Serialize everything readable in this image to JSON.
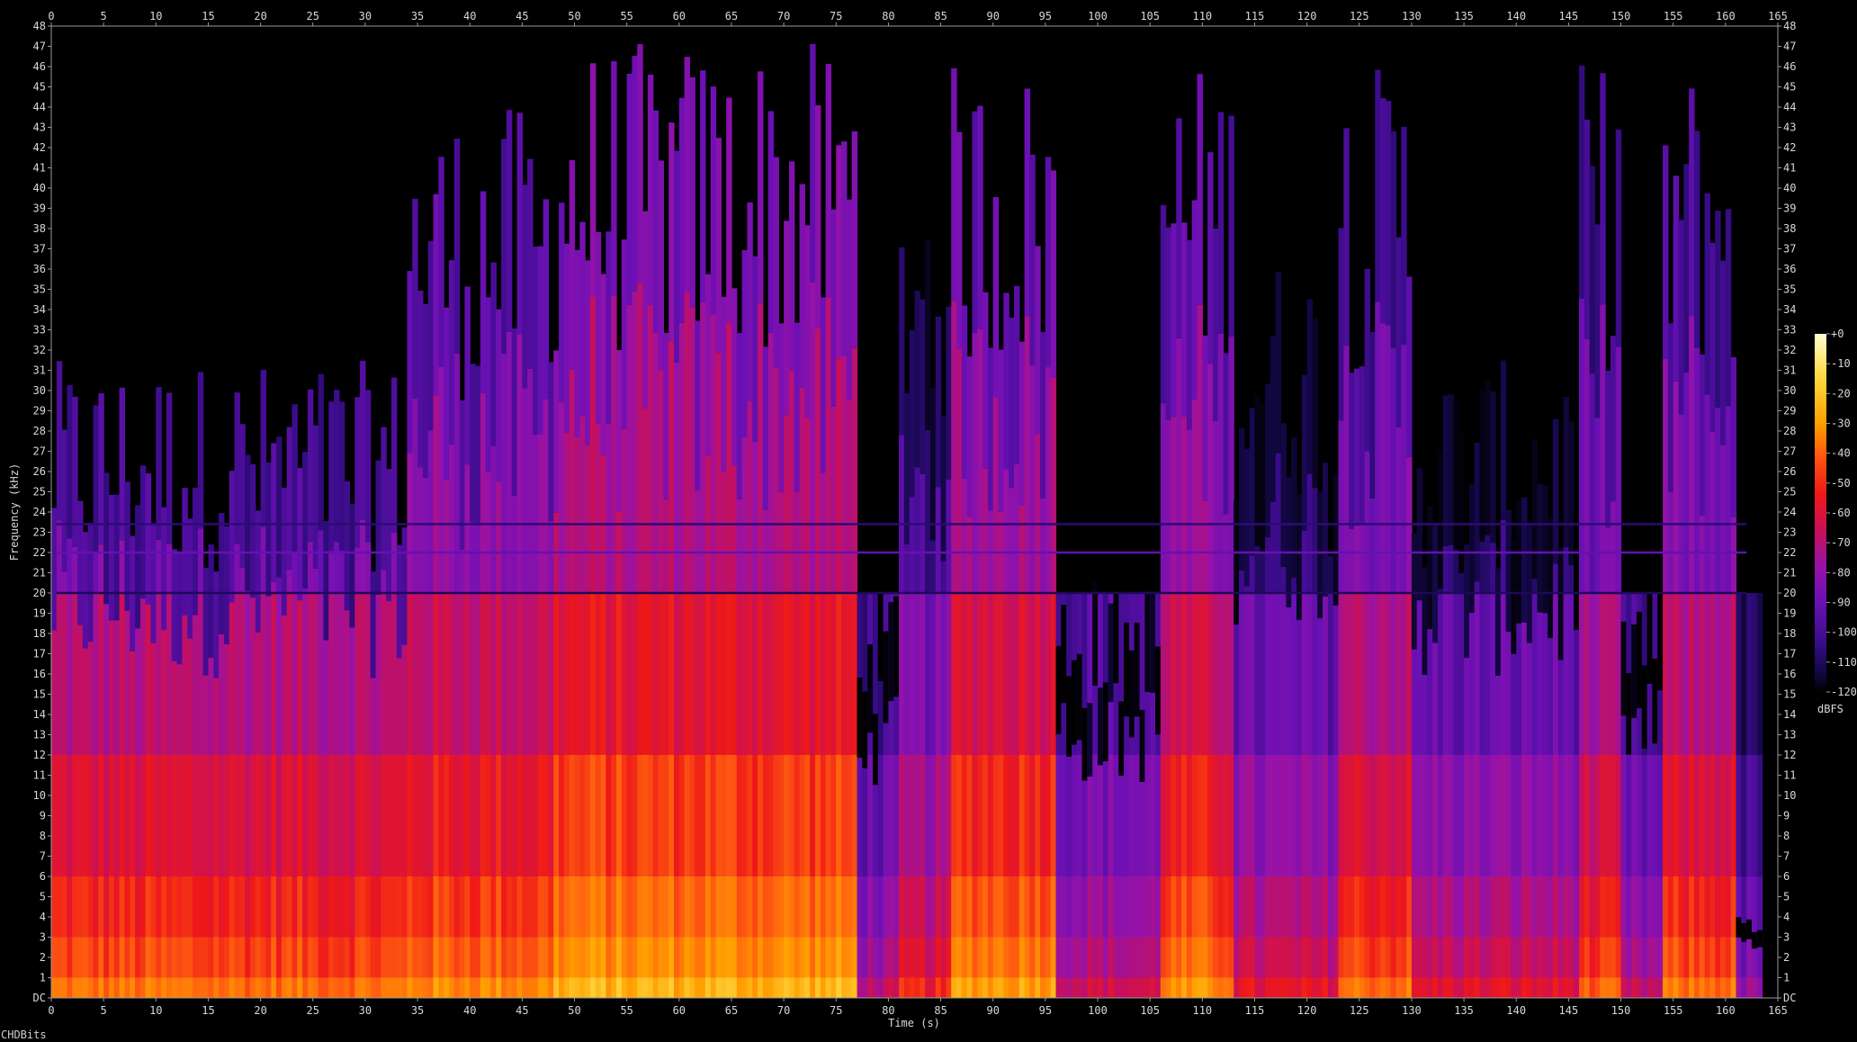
{
  "chart_data": {
    "type": "heatmap",
    "xlabel": "Time (s)",
    "ylabel": "Frequency (kHz)",
    "xlim": [
      0,
      165
    ],
    "ylim": [
      0,
      48
    ],
    "x_ticks": [
      0,
      5,
      10,
      15,
      20,
      25,
      30,
      35,
      40,
      45,
      50,
      55,
      60,
      65,
      70,
      75,
      80,
      85,
      90,
      95,
      100,
      105,
      110,
      115,
      120,
      125,
      130,
      135,
      140,
      145,
      150,
      155,
      160,
      165
    ],
    "y_ticks": [
      "DC",
      "1",
      "2",
      "3",
      "4",
      "5",
      "6",
      "7",
      "8",
      "9",
      "10",
      "11",
      "12",
      "13",
      "14",
      "15",
      "16",
      "17",
      "18",
      "19",
      "20",
      "21",
      "22",
      "23",
      "24",
      "25",
      "26",
      "27",
      "28",
      "29",
      "30",
      "31",
      "32",
      "33",
      "34",
      "35",
      "36",
      "37",
      "38",
      "39",
      "40",
      "41",
      "42",
      "43",
      "44",
      "45",
      "46",
      "47",
      "48"
    ],
    "colorbar": {
      "label": "dBFS",
      "range": [
        -120,
        0
      ],
      "ticks": [
        "+0",
        "-10",
        "-20",
        "-30",
        "-40",
        "-50",
        "-60",
        "-70",
        "-80",
        "-90",
        "-100",
        "-110",
        "-120"
      ],
      "colors": [
        "#000000",
        "#14084a",
        "#3a0c8a",
        "#6a10b4",
        "#9612a8",
        "#c8105a",
        "#ee1818",
        "#ff6010",
        "#ffa000",
        "#ffd840",
        "#ffffc8"
      ]
    },
    "signal_end_s": 163.5,
    "horizontal_lines_khz": [
      {
        "freq": 22.0,
        "level_dbfs": -85
      },
      {
        "freq": 23.4,
        "level_dbfs": -100
      },
      {
        "freq": 20.0,
        "level_dbfs": -105
      }
    ],
    "segments": [
      {
        "start": 0.5,
        "end": 34,
        "level_dbfs": -55,
        "top_khz": 30
      },
      {
        "start": 34,
        "end": 48,
        "level_dbfs": -50,
        "top_khz": 42
      },
      {
        "start": 48,
        "end": 77,
        "level_dbfs": -42,
        "top_khz": 45
      },
      {
        "start": 77,
        "end": 81,
        "level_dbfs": -85,
        "top_khz": 20
      },
      {
        "start": 81,
        "end": 86,
        "level_dbfs": -70,
        "top_khz": 40
      },
      {
        "start": 86,
        "end": 96,
        "level_dbfs": -45,
        "top_khz": 44
      },
      {
        "start": 96,
        "end": 106,
        "level_dbfs": -80,
        "top_khz": 20
      },
      {
        "start": 106,
        "end": 113,
        "level_dbfs": -50,
        "top_khz": 44
      },
      {
        "start": 113,
        "end": 123,
        "level_dbfs": -75,
        "top_khz": 35
      },
      {
        "start": 123,
        "end": 130,
        "level_dbfs": -55,
        "top_khz": 44
      },
      {
        "start": 130,
        "end": 146,
        "level_dbfs": -75,
        "top_khz": 30
      },
      {
        "start": 146,
        "end": 150,
        "level_dbfs": -60,
        "top_khz": 44
      },
      {
        "start": 150,
        "end": 154,
        "level_dbfs": -85,
        "top_khz": 20
      },
      {
        "start": 154,
        "end": 161,
        "level_dbfs": -55,
        "top_khz": 44
      },
      {
        "start": 161,
        "end": 163.5,
        "level_dbfs": -95,
        "top_khz": 4
      }
    ]
  },
  "footer": {
    "label": "CHDBits"
  }
}
